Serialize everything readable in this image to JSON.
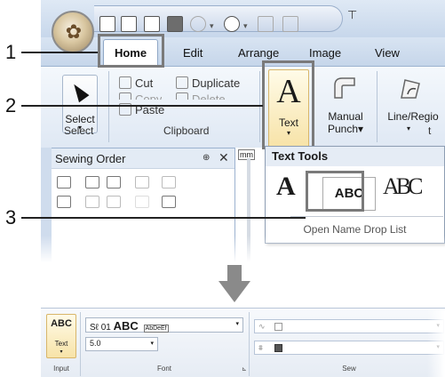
{
  "callouts": {
    "one": "1",
    "two": "2",
    "three": "3"
  },
  "tabs": [
    {
      "label": "Home"
    },
    {
      "label": "Edit"
    },
    {
      "label": "Arrange"
    },
    {
      "label": "Image"
    },
    {
      "label": "View"
    }
  ],
  "ribbon": {
    "select_label": "Select",
    "select_group": "Select",
    "clipboard": {
      "cut": "Cut",
      "duplicate": "Duplicate",
      "copy": "Copy",
      "delete": "Delete",
      "paste": "Paste",
      "group": "Clipboard"
    },
    "text_label": "Text",
    "manual_label": "Manual",
    "manual_label2": "Punch",
    "line_label": "Line/Regio",
    "group_tail": "t"
  },
  "sewing_order": {
    "title": "Sewing Order",
    "pin": "⊕",
    "close": "✕"
  },
  "canvas": {
    "unit": "mm"
  },
  "text_tools": {
    "title": "Text Tools",
    "tool_a": "A",
    "tool_abc": "ABC",
    "tool_mono": "ABC",
    "open_name": "Open Name Drop List"
  },
  "bottom_ribbon": {
    "abc": "ABC",
    "text": "Text",
    "input_group": "Input",
    "font_prefix": "01",
    "font_preview": "ABC",
    "font_small": "AbDeEf",
    "size_value": "5.0",
    "font_group": "Font",
    "sew_group": "Sew"
  },
  "icons": {
    "orb": "app-orb-icon",
    "down_arrow": "down-arrow-icon",
    "select": "select-arrow-icon",
    "text": "text-a-icon",
    "manual_punch": "manual-punch-icon",
    "line_region": "line-region-icon"
  }
}
